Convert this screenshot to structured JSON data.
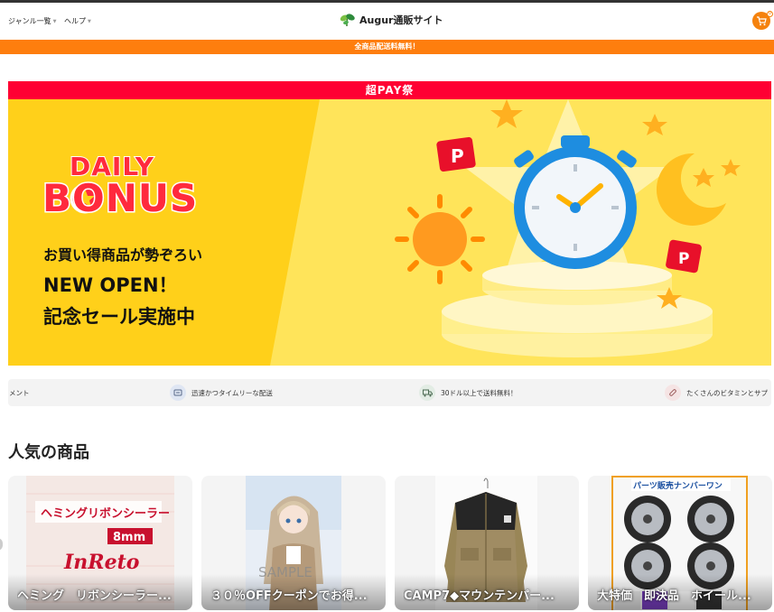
{
  "header": {
    "nav": [
      {
        "label": "ジャンル一覧"
      },
      {
        "label": "ヘルプ"
      }
    ],
    "logo_text": "Augur通販サイト",
    "cart_count": "0",
    "cart_icon": "cart-icon",
    "accent_color": "#f5820d"
  },
  "promo_bar": {
    "text": "全商品配送料無料！",
    "color": "#fe7e0e"
  },
  "banner": {
    "top_label": "超PAY祭",
    "title_line1": "DAILY",
    "title_line2": "BONUS",
    "subtitle": "お買い得商品が勢ぞろい",
    "headline": "NEW OPEN！",
    "sale": "記念セール実施中"
  },
  "features": [
    {
      "label": "メント",
      "icon": "leaf-icon"
    },
    {
      "label": "迅速かつタイムリーな配送",
      "icon": "clock-delivery-icon"
    },
    {
      "label": "30ドル以上で送料無料！",
      "icon": "truck-icon"
    },
    {
      "label": "たくさんのビタミンとサプ",
      "icon": "pill-icon"
    }
  ],
  "section": {
    "title": "人気の商品"
  },
  "products": [
    {
      "title": "ヘミング　リボンシーラー..."
    },
    {
      "title": "３０％OFFクーポンでお得..."
    },
    {
      "title": "CAMP7◆マウンテンパー..."
    },
    {
      "title": "大特価　即決品　ホイール..."
    }
  ]
}
